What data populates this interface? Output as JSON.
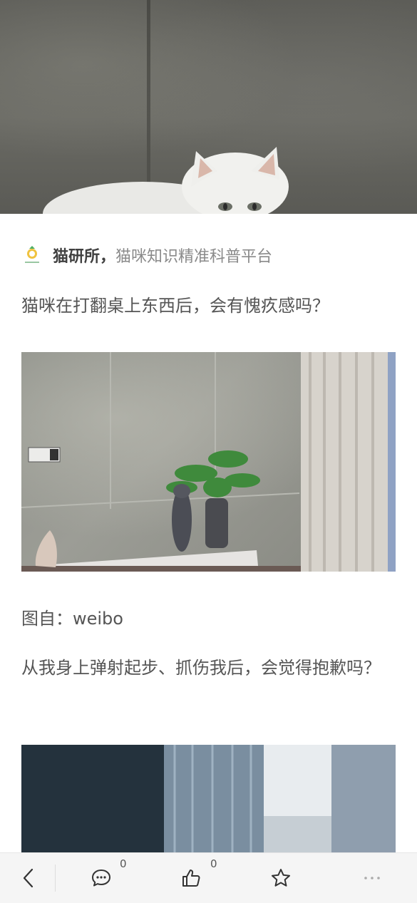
{
  "article": {
    "source_name": "猫研所，",
    "source_desc": "猫咪知识精准科普平台",
    "paragraph1": "猫咪在打翻桌上东西后，会有愧疚感吗？",
    "caption": "图自：weibo",
    "paragraph2": "从我身上弹射起步、抓伤我后，会觉得抱歉吗？"
  },
  "toolbar": {
    "comment_count": "0",
    "like_count": "0"
  },
  "icons": {
    "back": "chevron-left-icon",
    "comment": "comment-bubble-icon",
    "like": "thumbs-up-icon",
    "favorite": "star-icon",
    "more": "more-dots-icon"
  }
}
